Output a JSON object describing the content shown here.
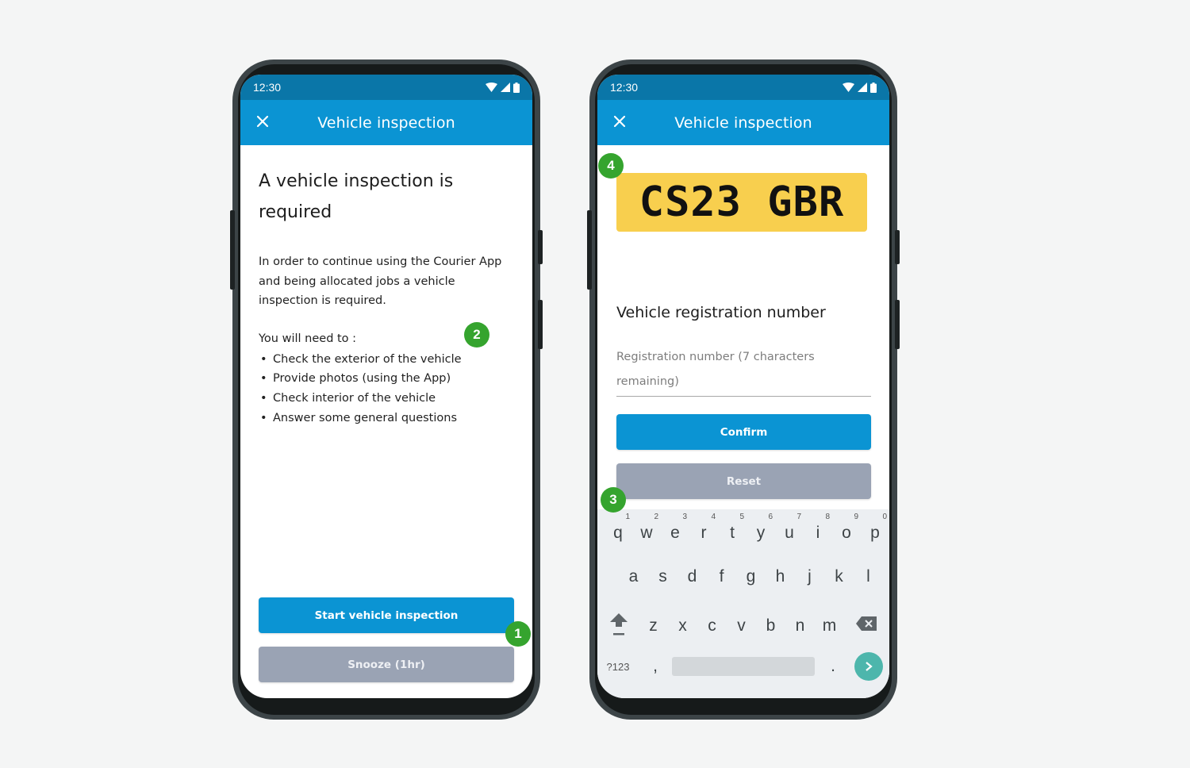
{
  "status_bar": {
    "time": "12:30",
    "icons": [
      "wifi-icon",
      "signal-icon",
      "battery-icon"
    ]
  },
  "app_bar": {
    "title": "Vehicle inspection",
    "close_icon": "close-icon"
  },
  "screen1": {
    "heading": "A vehicle inspection is required",
    "paragraph": "In order to continue using the Courier App and being allocated jobs a vehicle inspection is required.",
    "need_label": "You will need to :",
    "tasks": [
      "Check the exterior of the vehicle",
      "Provide photos (using the App)",
      "Check interior of the vehicle",
      "Answer some general questions"
    ],
    "primary_button": "Start vehicle inspection",
    "secondary_button": "Snooze (1hr)"
  },
  "screen2": {
    "plate": "CS23 GBR",
    "reg_label": "Vehicle registration number",
    "reg_placeholder": "Registration number (7 characters remaining)",
    "primary_button": "Confirm",
    "secondary_button": "Reset"
  },
  "keyboard": {
    "row1": [
      {
        "key": "q",
        "hint": "1"
      },
      {
        "key": "w",
        "hint": "2"
      },
      {
        "key": "e",
        "hint": "3"
      },
      {
        "key": "r",
        "hint": "4"
      },
      {
        "key": "t",
        "hint": "5"
      },
      {
        "key": "y",
        "hint": "6"
      },
      {
        "key": "u",
        "hint": "7"
      },
      {
        "key": "i",
        "hint": "8"
      },
      {
        "key": "o",
        "hint": "9"
      },
      {
        "key": "p",
        "hint": "0"
      }
    ],
    "row2": [
      "a",
      "s",
      "d",
      "f",
      "g",
      "h",
      "j",
      "k",
      "l"
    ],
    "row3": [
      "z",
      "x",
      "c",
      "v",
      "b",
      "n",
      "m"
    ],
    "symbols_key": "?123",
    "comma_key": ",",
    "period_key": "."
  },
  "badges": [
    "1",
    "2",
    "3",
    "4"
  ],
  "colors": {
    "primary": "#0b94d3",
    "status_bar": "#0a76a8",
    "secondary_button": "#9aa3b4",
    "badge": "#35a42e",
    "plate": "#f8cf4e",
    "enter_key": "#4db6ac"
  }
}
